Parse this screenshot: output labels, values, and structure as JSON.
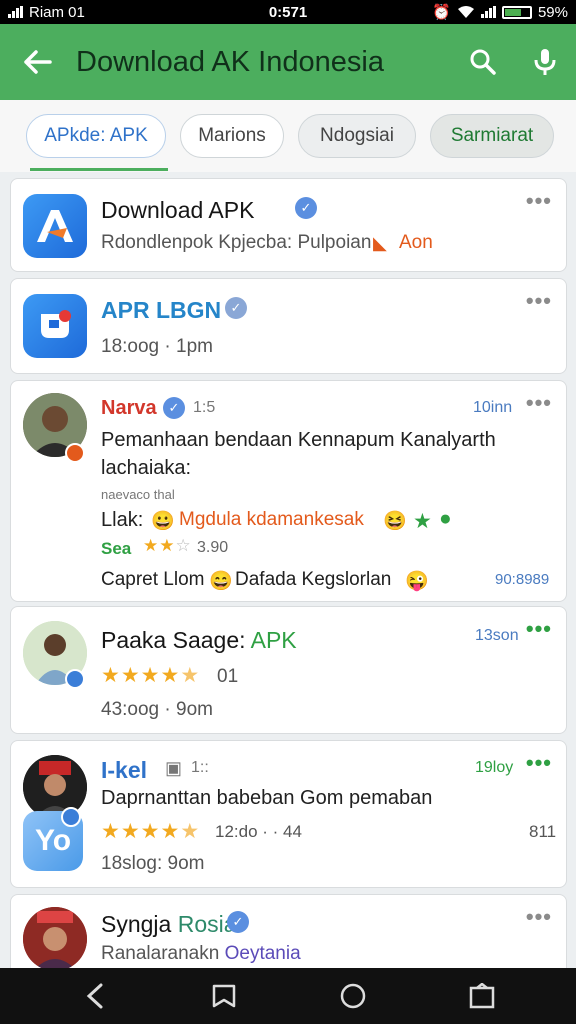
{
  "status_bar": {
    "carrier": "Riam 01",
    "time": "0:571",
    "battery": "59%"
  },
  "app_bar": {
    "title": "Download AK Indonesia"
  },
  "chips": [
    "APkde: APK",
    "Marions",
    "Ndogsiai",
    "Sarmiarat"
  ],
  "cards": {
    "c1": {
      "name": "Download APK",
      "subtitle": "Rdondlenpok Kpjecba: Pulpoian",
      "tag": "Aon"
    },
    "c2": {
      "name": "APR LBGN",
      "subtitle": "18:oog · 1pm"
    },
    "c3": {
      "name": "Narva",
      "meta": "1:5",
      "time": "10inn",
      "line1": "Pemanhaan bendaan Kennapum Kanalyarth",
      "line2": "lachaiaka:",
      "small": "naevaco thal",
      "lak_label": "Llak:",
      "lak_text": "Mgdula kdamankesak",
      "rating_prefix": "Sea",
      "rating_value": "3.90",
      "bottom_a": "Capret Llom",
      "bottom_b": "Dafada Kegslorlan",
      "bottom_time": "90:8989"
    },
    "c4": {
      "name": "Paaka Saage: ",
      "name_accent": "APK",
      "time": "13son",
      "rating": "01",
      "subtitle": "43:oog · 9om"
    },
    "c5": {
      "name": "I-kel",
      "meta": "1::",
      "time": "19loy",
      "line1": "Daprnanttan babeban Gom pemaban",
      "rating": "12:do · · 44",
      "count": "811",
      "subtitle": "18slog: 9om"
    },
    "c6": {
      "name_a": "Syngja ",
      "name_b": "Rosia",
      "subtitle_a": "Ranalaranakn ",
      "subtitle_b": "Oeytania"
    }
  },
  "colors": {
    "app_bar": "#4cae5e",
    "accent_blue": "#2f72c9",
    "verified": "#5b8fe0",
    "star": "#f2a91f",
    "orange": "#e35a1c",
    "green_text": "#2fa043"
  }
}
